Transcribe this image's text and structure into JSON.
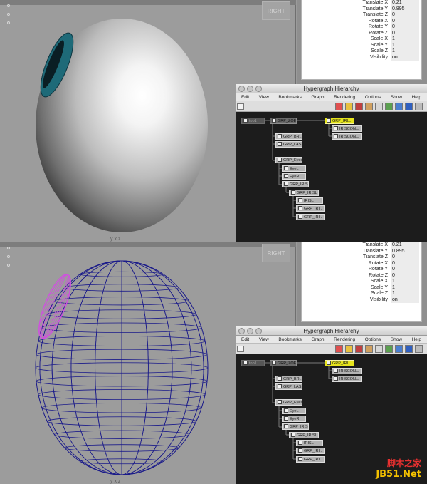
{
  "panels": [
    {
      "id": "shaded",
      "viewport": {
        "view_cube_label": "RIGHT",
        "axis_label": "y x z",
        "shading": "smooth"
      },
      "attributes": [
        {
          "label": "Translate X",
          "value": "0.21"
        },
        {
          "label": "Translate Y",
          "value": "0.895"
        },
        {
          "label": "Translate Z",
          "value": "0"
        },
        {
          "label": "Rotate X",
          "value": "0"
        },
        {
          "label": "Rotate Y",
          "value": "0"
        },
        {
          "label": "Rotate Z",
          "value": "0"
        },
        {
          "label": "Scale X",
          "value": "1"
        },
        {
          "label": "Scale Y",
          "value": "1"
        },
        {
          "label": "Scale Z",
          "value": "1"
        },
        {
          "label": "Visibility",
          "value": "on"
        }
      ]
    },
    {
      "id": "wireframe",
      "viewport": {
        "view_cube_label": "RIGHT",
        "axis_label": "y x z",
        "shading": "wireframe"
      },
      "attributes": [
        {
          "label": "Translate X",
          "value": "0.21"
        },
        {
          "label": "Translate Y",
          "value": "0.895"
        },
        {
          "label": "Translate Z",
          "value": "0"
        },
        {
          "label": "Rotate X",
          "value": "0"
        },
        {
          "label": "Rotate Y",
          "value": "0"
        },
        {
          "label": "Rotate Z",
          "value": "0"
        },
        {
          "label": "Scale X",
          "value": "1"
        },
        {
          "label": "Scale Y",
          "value": "1"
        },
        {
          "label": "Scale Z",
          "value": "1"
        },
        {
          "label": "Visibility",
          "value": "on"
        }
      ]
    }
  ],
  "hypergraph": {
    "title": "Hypergraph Hierarchy",
    "menu": [
      "Edit",
      "View",
      "Bookmarks",
      "Graph",
      "Rendering",
      "Options",
      "Show",
      "Help"
    ],
    "nodes": {
      "top": "top1",
      "zoe": "GRP_ZOE",
      "br": "GRP_BR...",
      "las": "GRP_LAS...",
      "eyes": "GRP_Eyes",
      "eyel": "EyeL",
      "eyer": "EyeR",
      "iris": "GRP_IRIS",
      "irisl": "GRP_IRISL",
      "irisl2": "IRISL",
      "iri1": "GRP_IRI...",
      "iri2": "GRP_IRI...",
      "selected": "GRP_IRI...",
      "con1": "IRISCON...",
      "con2": "IRISCON..."
    }
  },
  "watermark": {
    "line1": "脚本之家",
    "line2": "JB51.Net"
  },
  "colors": {
    "iris": "#1e6a78",
    "wire": "#1a1a8a",
    "wire_selected": "#d050e0",
    "highlight": "#e6e41c"
  }
}
